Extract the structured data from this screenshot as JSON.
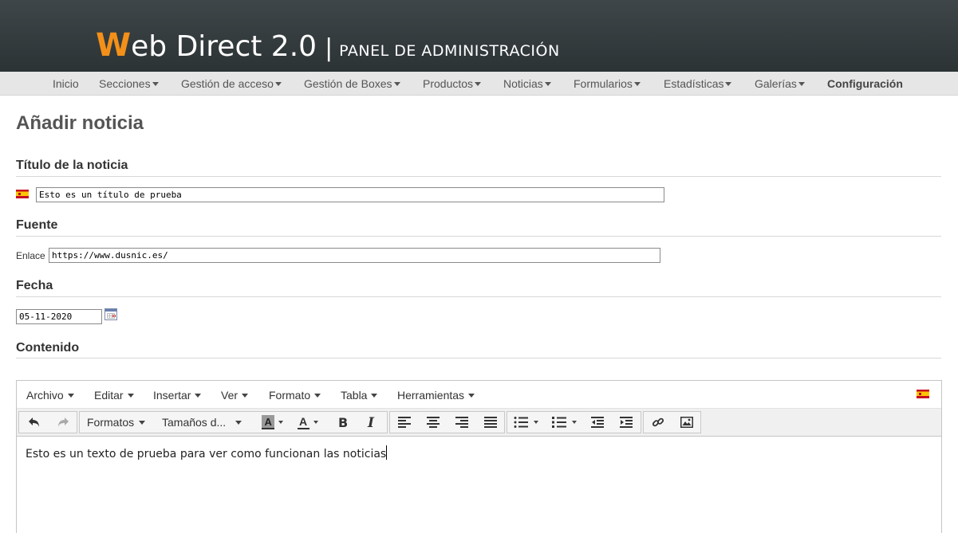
{
  "header": {
    "brand_w": "W",
    "brand_rest": "eb Direct 2.0",
    "brand_sep": "|",
    "subtitle": "PANEL DE ADMINISTRACIÓN",
    "accent_color": "#f39019"
  },
  "nav": {
    "items": [
      {
        "label": "Inicio",
        "dropdown": false
      },
      {
        "label": "Secciones",
        "dropdown": true
      },
      {
        "label": "Gestión de acceso",
        "dropdown": true
      },
      {
        "label": "Gestión de Boxes",
        "dropdown": true
      },
      {
        "label": "Productos",
        "dropdown": true
      },
      {
        "label": "Noticias",
        "dropdown": true
      },
      {
        "label": "Formularios",
        "dropdown": true
      },
      {
        "label": "Estadísticas",
        "dropdown": true
      },
      {
        "label": "Galerías",
        "dropdown": true
      },
      {
        "label": "Configuración",
        "dropdown": false
      }
    ]
  },
  "page": {
    "title": "Añadir noticia"
  },
  "titulo": {
    "heading": "Título de la noticia",
    "flag_icon": "spain-flag-icon",
    "value": "Esto es un título de prueba"
  },
  "fuente": {
    "heading": "Fuente",
    "link_label": "Enlace",
    "value": "https://www.dusnic.es/"
  },
  "fecha": {
    "heading": "Fecha",
    "value": "05-11-2020",
    "calendar_icon": "calendar-icon"
  },
  "contenido": {
    "heading": "Contenido"
  },
  "editor": {
    "menu": [
      "Archivo",
      "Editar",
      "Insertar",
      "Ver",
      "Formato",
      "Tabla",
      "Herramientas"
    ],
    "language_icon": "spain-flag-icon",
    "toolbar": {
      "formats_label": "Formatos",
      "sizes_label": "Tamaños d...",
      "icons": [
        "undo-icon",
        "redo-icon",
        "background-color-icon",
        "text-color-icon",
        "bold-icon",
        "italic-icon",
        "align-left-icon",
        "align-center-icon",
        "align-right-icon",
        "align-justify-icon",
        "bullet-list-icon",
        "numbered-list-icon",
        "outdent-icon",
        "indent-icon",
        "link-icon",
        "image-icon"
      ]
    },
    "content": "Esto es un texto de prueba para ver como funcionan las noticias"
  }
}
